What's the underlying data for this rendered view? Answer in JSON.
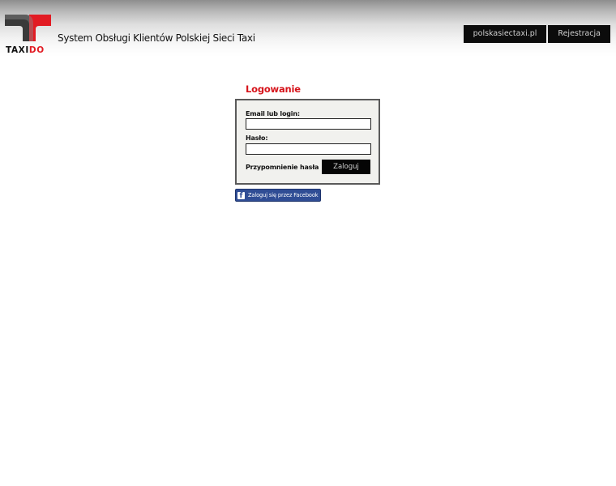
{
  "header": {
    "logo_text": "TAXIDO",
    "site_title": "System Obsługi Klientów Polskiej Sieci Taxi",
    "nav": [
      {
        "label": "polskasiectaxi.pl"
      },
      {
        "label": "Rejestracja"
      }
    ]
  },
  "login": {
    "heading": "Logowanie",
    "email_label": "Email lub login:",
    "email_value": "",
    "password_label": "Hasło:",
    "password_value": "",
    "remind_label": "Przypomnienie hasła",
    "submit_label": "Zaloguj"
  },
  "facebook": {
    "label": "Zaloguj się przez Facebook",
    "icon": "facebook-icon"
  },
  "colors": {
    "brand_red": "#d6131a",
    "heading_red": "#d6131a",
    "facebook_blue": "#2f4d95",
    "button_black": "#0c0c0c"
  }
}
